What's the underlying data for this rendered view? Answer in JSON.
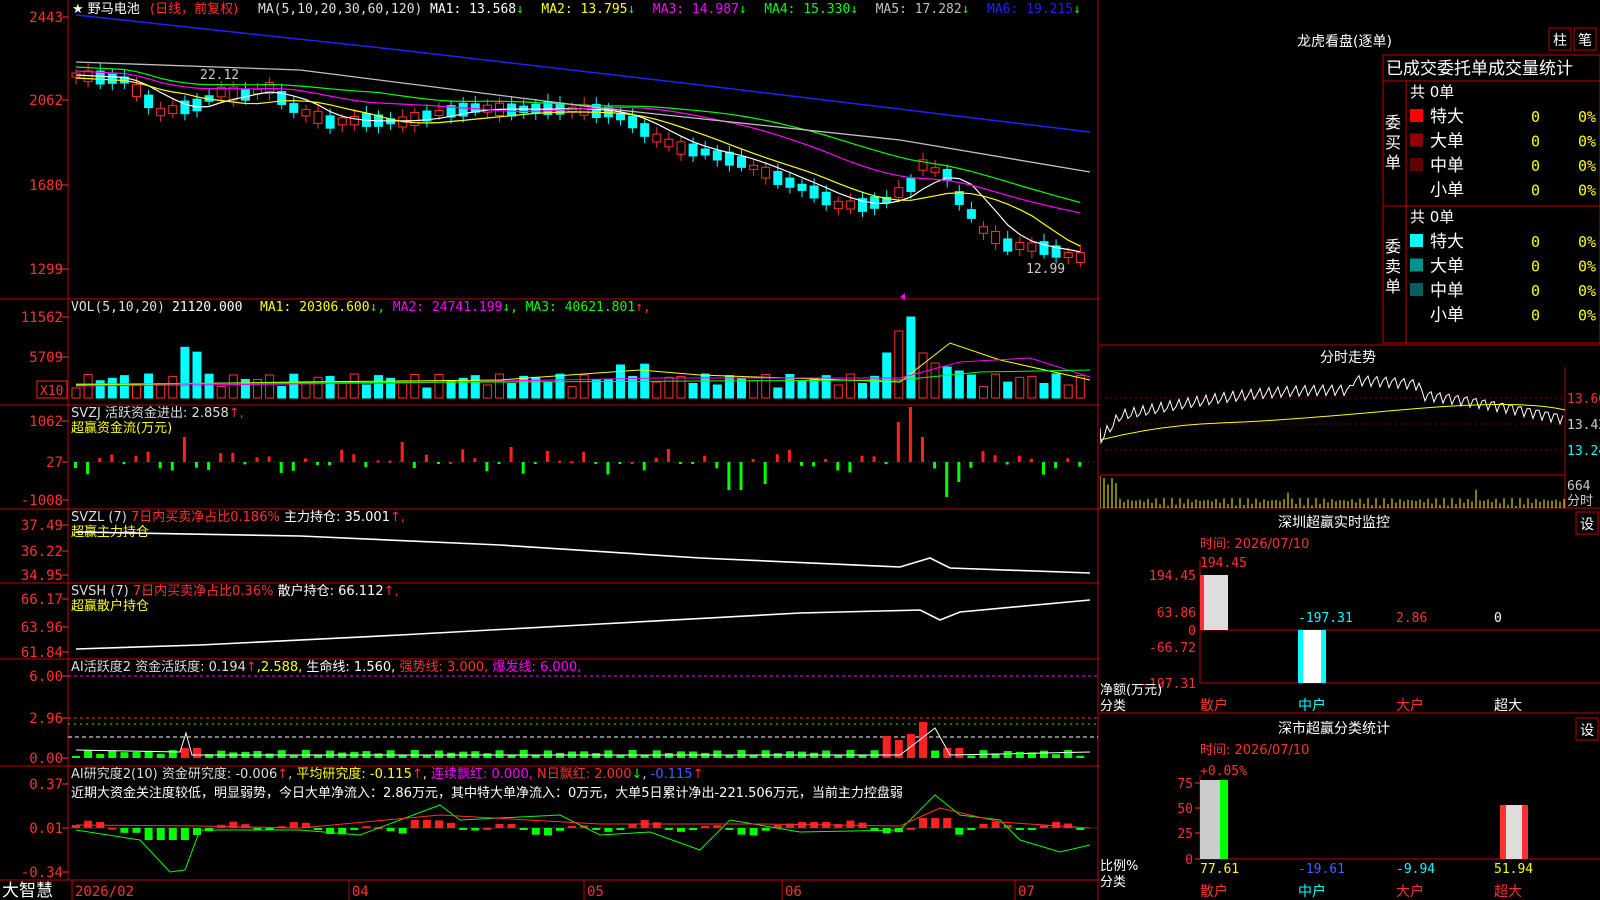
{
  "stock": {
    "name": "野马电池",
    "period": "(日线，前复权)"
  },
  "main_chart": {
    "ma_params": "MA(5,10,20,30,60,120)",
    "ma_items": [
      {
        "label": "MA1: 13.568",
        "arrow": "↓",
        "color": "#ffffff"
      },
      {
        "label": "MA2: 13.795",
        "arrow": "↓",
        "color": "#ffff00"
      },
      {
        "label": "MA3: 14.987",
        "arrow": "↓",
        "color": "#ff00ff"
      },
      {
        "label": "MA4: 15.330",
        "arrow": "↓",
        "color": "#00ff00"
      },
      {
        "label": "MA5: 17.282",
        "arrow": "↓",
        "color": "#c0c0c0"
      },
      {
        "label": "MA6: 19.215",
        "arrow": "↓",
        "color": "#2020ff"
      }
    ],
    "y_ticks": [
      "2443",
      "2062",
      "1680",
      "1299"
    ],
    "high_label": "22.12",
    "low_label": "12.99"
  },
  "vol": {
    "title": "VOL(5,10,20)",
    "value": "21120.000",
    "items": [
      {
        "label": "MA1: 20306.600",
        "arrow": "↓",
        "color": "#ffff00"
      },
      {
        "label": "MA2: 24741.199",
        "arrow": "↓",
        "color": "#ff00ff"
      },
      {
        "label": "MA3: 40621.801",
        "arrow": "↑",
        "color": "#00ff00"
      }
    ],
    "y_ticks": [
      "11562",
      "5709"
    ],
    "unit": "X10"
  },
  "svzj": {
    "title": "SVZJ",
    "line1": "活跃资金进出: 2.858",
    "line2": "超赢资金流(万元)",
    "y_ticks": [
      "1062",
      "27",
      "-1008"
    ]
  },
  "svzl": {
    "title": "SVZL (7)",
    "t1": "7日内买卖净占比0.186%",
    "t2": "主力持仓: 35.001",
    "line2": "超赢主力持仓",
    "y_ticks": [
      "37.49",
      "36.22",
      "34.95"
    ]
  },
  "svsh": {
    "title": "SVSH (7)",
    "t1": "7日内买卖净占比0.36%",
    "t2": "散户持仓: 66.112",
    "line2": "超赢散户持仓",
    "y_ticks": [
      "66.17",
      "63.96",
      "61.84"
    ]
  },
  "ai1": {
    "title": "AI活跃度2",
    "t1": "资金活跃度: 0.194",
    "t2": "2.588,",
    "t3": "生命线: 1.560,",
    "t4": "强势线: 3.000,",
    "t5": "爆发线: 6.000,",
    "y_ticks": [
      "6.00",
      "2.96",
      "0.00"
    ]
  },
  "ai2": {
    "title": "AI研究度2(10)",
    "t1": "资金研究度: -0.006",
    "t2": "平均研究度: -0.115",
    "t3": "连续飘红: 0.000,",
    "t4": "N日飘红: 2.000",
    "t5": "-0.115",
    "comment": "近期大资金关注度较低，明显弱势，今日大单净流入：2.86万元，其中特大单净流入：0万元，大单5日累计净出-221.506万元，当前主力控盘弱",
    "y_ticks": [
      "0.37",
      "0.01",
      "-0.34"
    ]
  },
  "bottom": {
    "brand": "大智慧",
    "dates": [
      "2026/02",
      "04",
      "05",
      "06",
      "07"
    ]
  },
  "dragon": {
    "title": "龙虎看盘(逐单)",
    "btn1": "柱",
    "btn2": "笔",
    "subtitle": "已成交委托单成交量统计",
    "buy_label": "委买单",
    "sell_label": "委卖单",
    "buy_total": "共 0单",
    "sell_total": "共 0单",
    "buy_rows": [
      {
        "name": "特大",
        "val": "0",
        "pct": "0%",
        "color": "#ff0000"
      },
      {
        "name": "大单",
        "val": "0",
        "pct": "0%",
        "color": "#900000"
      },
      {
        "name": "中单",
        "val": "0",
        "pct": "0%",
        "color": "#600000"
      },
      {
        "name": "小单",
        "val": "0",
        "pct": "0%",
        "color": "#000000"
      }
    ],
    "sell_rows": [
      {
        "name": "特大",
        "val": "0",
        "pct": "0%",
        "color": "#00ffff"
      },
      {
        "name": "大单",
        "val": "0",
        "pct": "0%",
        "color": "#009090"
      },
      {
        "name": "中单",
        "val": "0",
        "pct": "0%",
        "color": "#006060"
      },
      {
        "name": "小单",
        "val": "0",
        "pct": "0%",
        "color": "#000000"
      }
    ]
  },
  "intraday": {
    "title": "分时走势",
    "price_ticks": [
      "13.60",
      "13.42",
      "13.24"
    ],
    "vol_tick": "664",
    "vol_unit": "分时"
  },
  "monitor": {
    "title": "深圳超赢实时监控",
    "btn": "设",
    "time": "时间: 2026/07/10",
    "y_ticks": [
      "194.45",
      "63.86",
      "0",
      "-66.72",
      "-197.31"
    ],
    "unit": "净额(万元)",
    "cat_label": "分类",
    "cats": [
      "散户",
      "中户",
      "大户",
      "超大"
    ],
    "values": [
      "194.45",
      "-197.31",
      "2.86",
      "0"
    ]
  },
  "classify": {
    "title": "深市超赢分类统计",
    "btn": "设",
    "time": "时间: 2026/07/10",
    "y_ticks": [
      "75",
      "50",
      "25",
      "0"
    ],
    "top_label": "+0.05%",
    "unit": "比例%",
    "cat_label": "分类",
    "cats": [
      "散户",
      "中户",
      "大户",
      "超大"
    ],
    "values": [
      "77.61",
      "-19.61",
      "-9.94",
      "51.94"
    ]
  }
}
